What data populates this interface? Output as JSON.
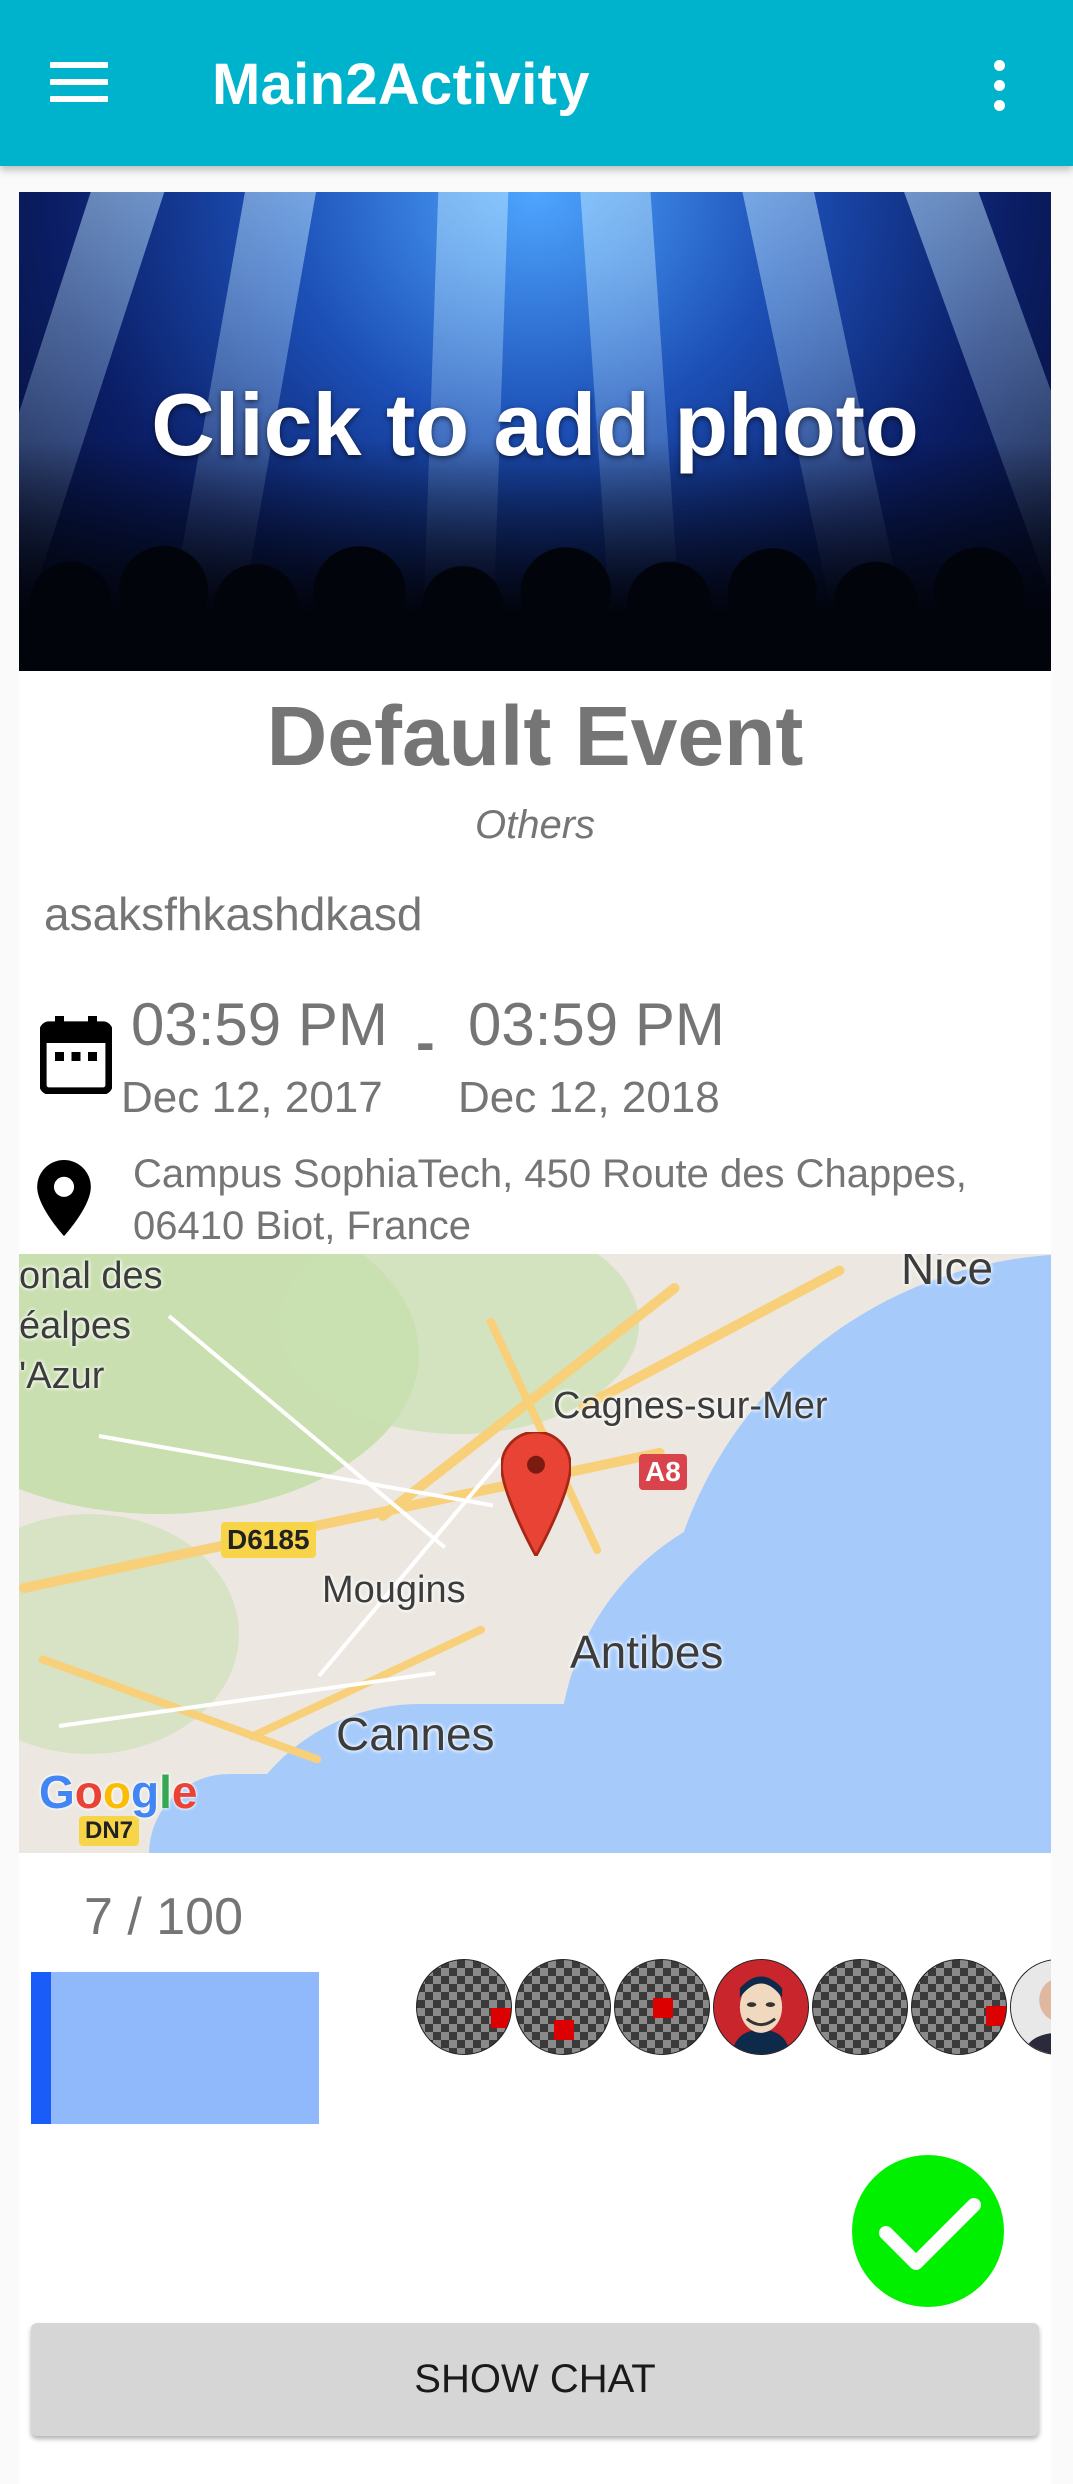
{
  "appbar": {
    "title": "Main2Activity",
    "menu_icon": "hamburger-menu-icon",
    "overflow_icon": "more-vert-icon",
    "color": "#00b3cc"
  },
  "banner": {
    "text": "Click to add photo"
  },
  "event": {
    "title": "Default Event",
    "category": "Others",
    "description": "asaksfhkashdkasd",
    "start_time": "03:59 PM",
    "end_time": "03:59 PM",
    "separator": "-",
    "start_date": "Dec 12, 2017",
    "end_date": "Dec 12, 2018",
    "address": "Campus SophiaTech, 450 Route des Chappes, 06410 Biot, France"
  },
  "map": {
    "labels": {
      "nice": "Nice",
      "region1": "onal des",
      "region2": "éalpes",
      "region3": "'Azur",
      "cagnes": "Cagnes-sur-Mer",
      "a8": "A8",
      "d6185": "D6185",
      "mougins": "Mougins",
      "antibes": "Antibes",
      "cannes": "Cannes",
      "dn7": "DN7"
    },
    "google": [
      "G",
      "o",
      "o",
      "g",
      "l",
      "e"
    ]
  },
  "participants": {
    "count_label": "7 / 100",
    "current": 7,
    "max": 100,
    "fill_fraction": 0.07
  },
  "actions": {
    "show_chat": "SHOW CHAT"
  },
  "colors": {
    "accent": "#00b3cc",
    "progress_bg": "#90b9fb",
    "progress_fill": "#1a5cf7",
    "check": "#00f000"
  }
}
